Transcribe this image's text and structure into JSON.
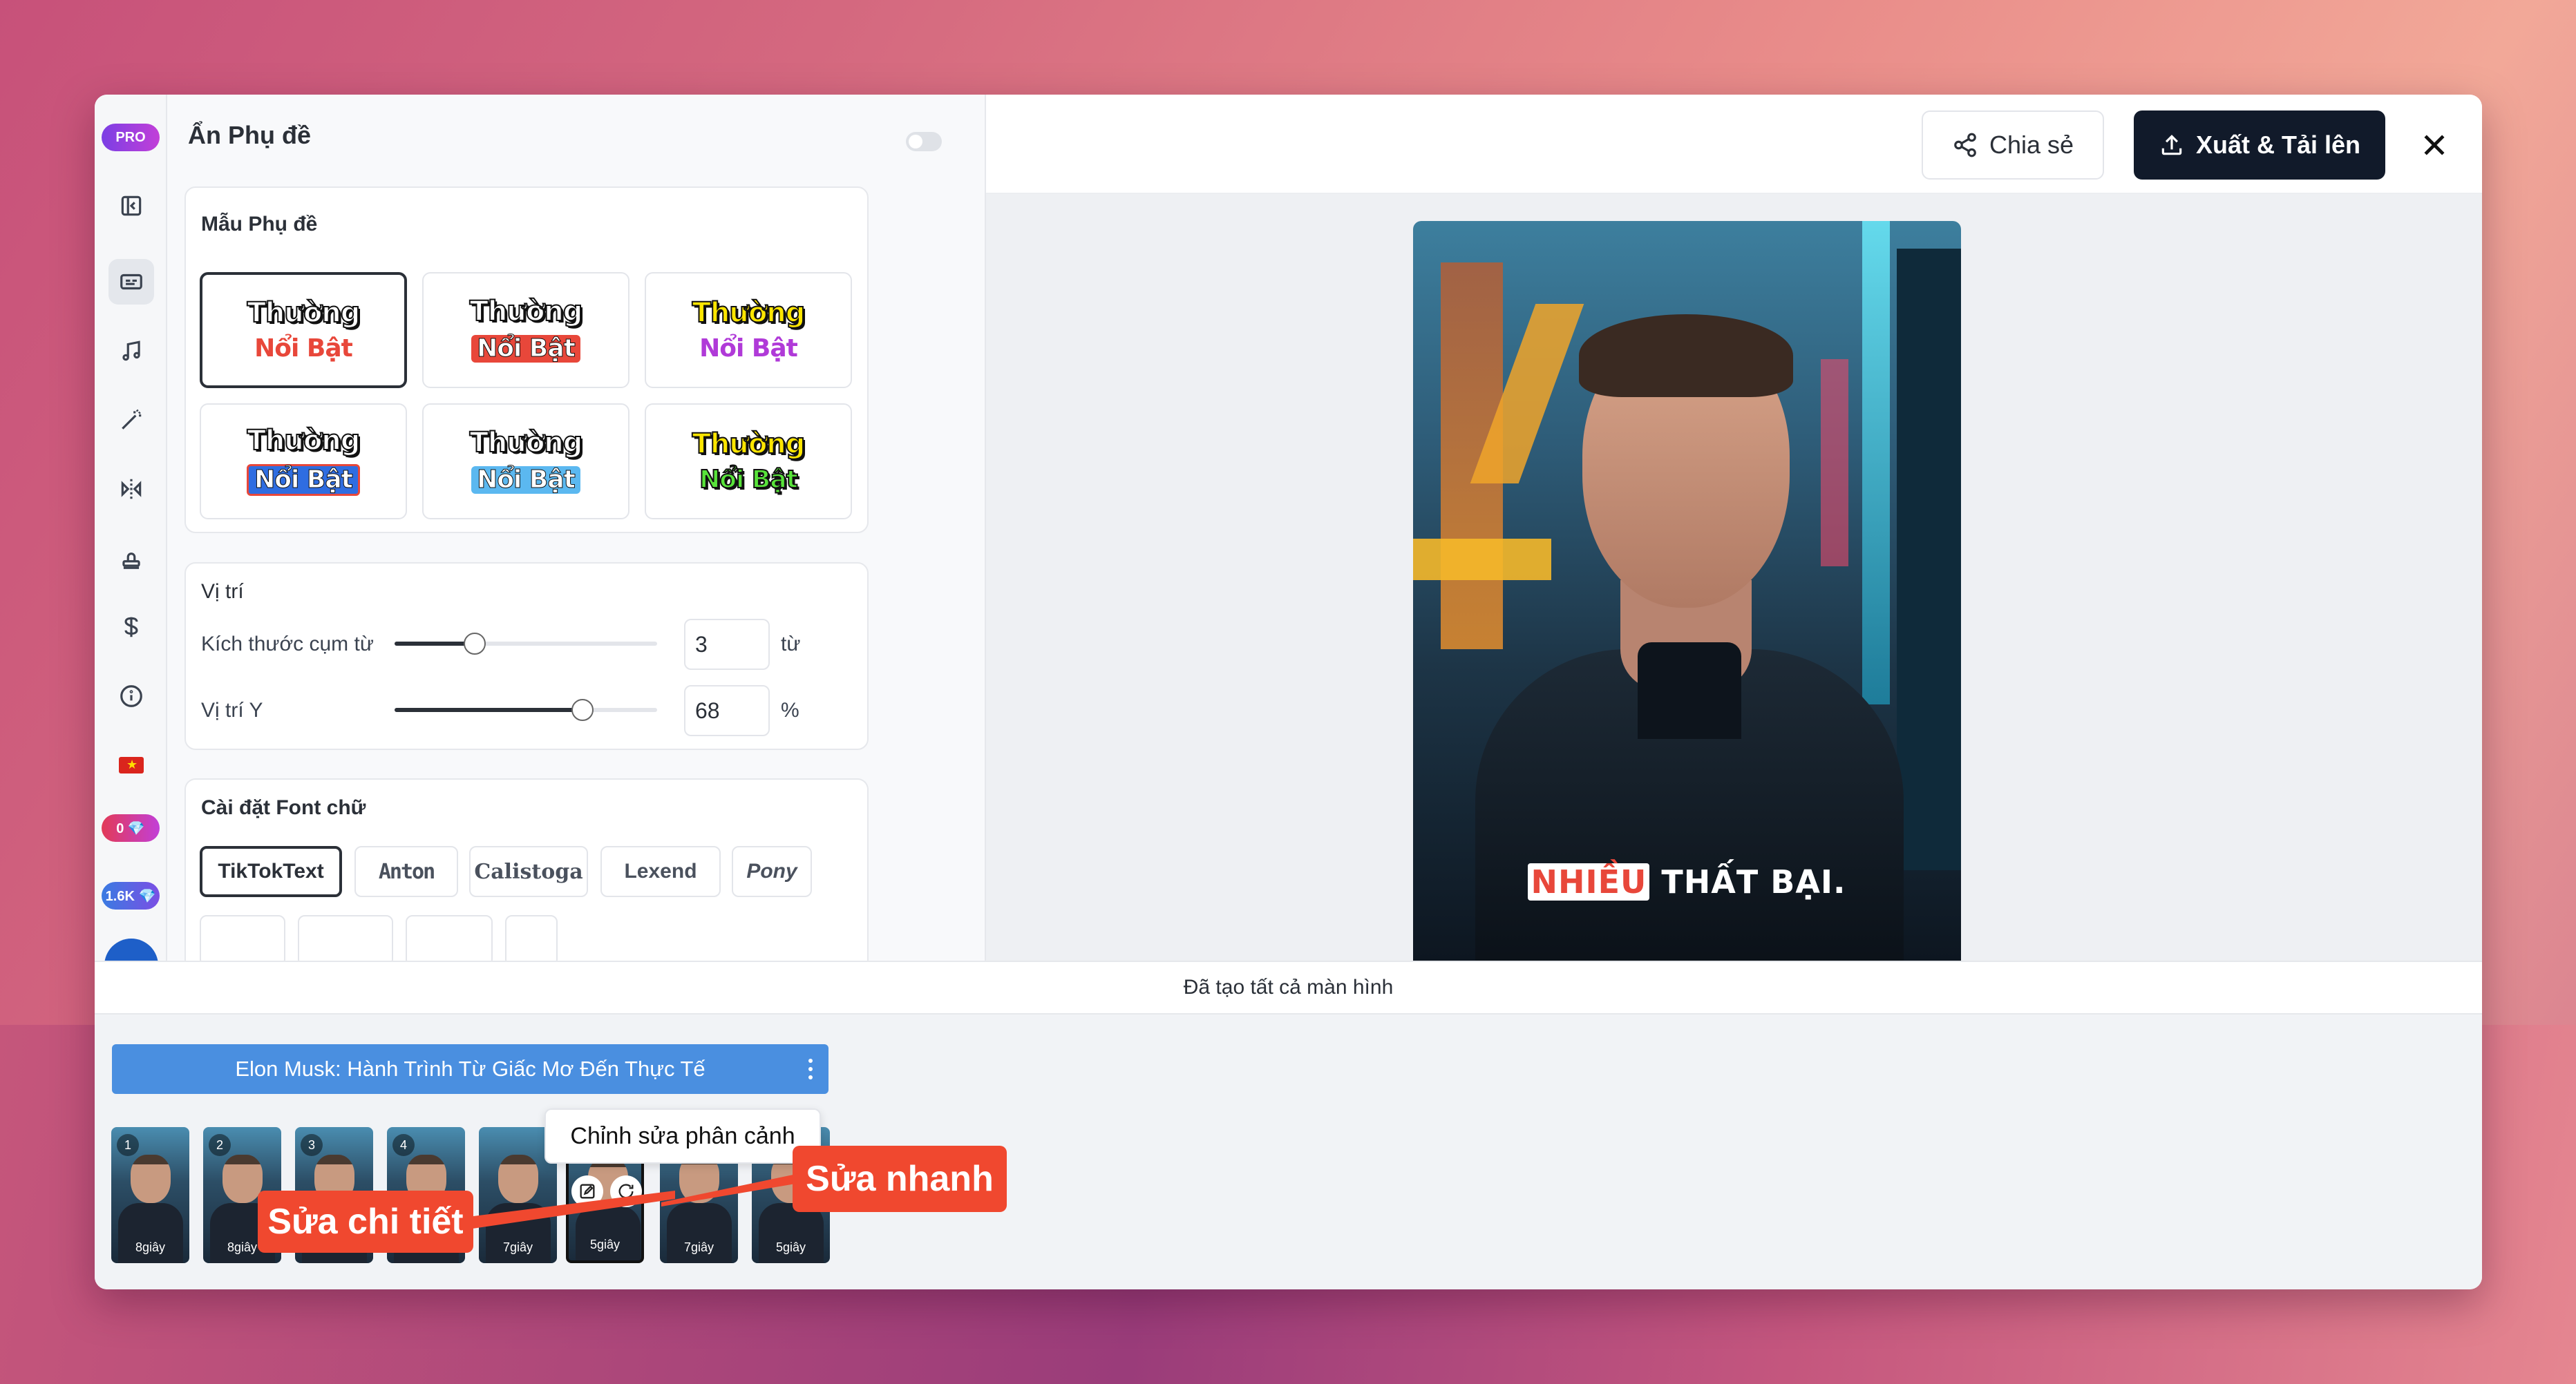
{
  "rail": {
    "pro_label": "PRO",
    "credits_a": "0 💎",
    "credits_b": "1.6K 💎"
  },
  "panel": {
    "hide_subtitles_label": "Ẩn Phụ đề",
    "templates": {
      "title": "Mẫu Phụ đề",
      "items": [
        {
          "top": "Thường",
          "bottom": "Nổi Bật"
        },
        {
          "top": "Thường",
          "bottom": "Nổi Bật"
        },
        {
          "top": "Thường",
          "bottom": "Nổi Bật"
        },
        {
          "top": "Thường",
          "bottom": "Nổi Bật"
        },
        {
          "top": "Thường",
          "bottom": "Nổi Bật"
        },
        {
          "top": "Thường",
          "bottom": "Nổi Bật"
        }
      ]
    },
    "position": {
      "title": "Vị trí",
      "phrase_size_label": "Kích thước cụm từ",
      "phrase_size_value": "3",
      "phrase_size_unit": "từ",
      "y_label": "Vị trí Y",
      "y_value": "68",
      "y_unit": "%"
    },
    "font": {
      "title": "Cài đặt Font chữ",
      "options": [
        "TikTokText",
        "Anton",
        "Calistoga",
        "Lexend",
        "Pony"
      ],
      "selected": "TikTokText"
    }
  },
  "topbar": {
    "share_label": "Chia sẻ",
    "export_label": "Xuất & Tải lên"
  },
  "video": {
    "caption_highlight": "NHIỀU",
    "caption_rest": "THẤT BẠI."
  },
  "status": "Đã tạo tất cả màn hình",
  "timeline": {
    "project_title": "Elon Musk: Hành Trình Từ Giấc Mơ Đến Thực Tế",
    "scenes": [
      {
        "index": "1",
        "duration": "8giây"
      },
      {
        "index": "2",
        "duration": "8giây"
      },
      {
        "index": "3",
        "duration": ""
      },
      {
        "index": "4",
        "duration": ""
      },
      {
        "index": "",
        "duration": "7giây"
      },
      {
        "index": "",
        "duration": "5giây"
      },
      {
        "index": "",
        "duration": "7giây"
      },
      {
        "index": "8",
        "duration": "5giây"
      }
    ],
    "tooltip": "Chỉnh sửa phân cảnh",
    "callout_detail": "Sửa chi tiết",
    "callout_quick": "Sửa nhanh"
  },
  "colors": {
    "accent_dark": "#111a2a",
    "project_blue": "#4a8fe0",
    "callout_red": "#f0482f"
  }
}
